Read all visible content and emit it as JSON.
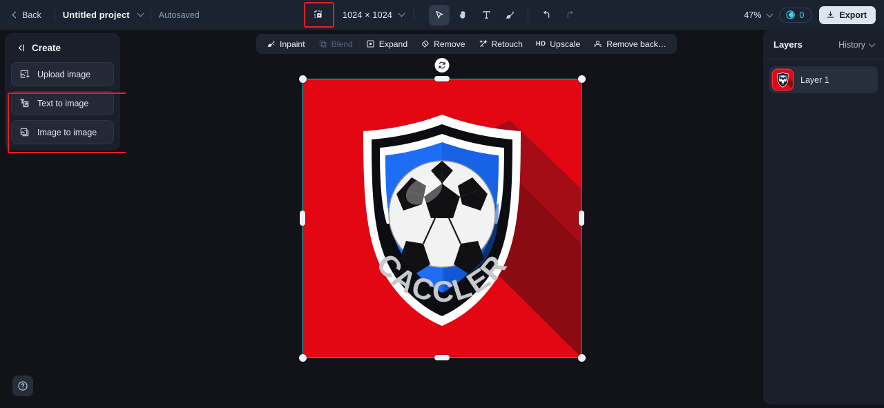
{
  "topbar": {
    "back_label": "Back",
    "project_name": "Untitled project",
    "autosaved_label": "Autosaved",
    "canvas_size": "1024 × 1024",
    "zoom_level": "47%",
    "credits_count": "0",
    "export_label": "Export",
    "icons": {
      "crop": "crop-frame-icon",
      "select": "cursor-select-icon",
      "hand": "hand-pan-icon",
      "text": "text-tool-icon",
      "brush": "brush-tool-icon",
      "undo": "undo-icon",
      "redo": "redo-icon"
    },
    "accent_red": "#ee1c25",
    "accent_cyan": "#3fd2ea"
  },
  "create_panel": {
    "title": "Create",
    "items": [
      {
        "label": "Upload image",
        "icon": "image-upload-icon",
        "highlighted": true
      },
      {
        "label": "Text to image",
        "icon": "text-to-image-icon",
        "highlighted": true
      },
      {
        "label": "Image to image",
        "icon": "image-to-image-icon",
        "highlighted": false
      }
    ]
  },
  "canvas_toolbar": {
    "items": [
      {
        "label": "Inpaint",
        "icon": "inpaint-brush-icon",
        "disabled": false
      },
      {
        "label": "Blend",
        "icon": "blend-icon",
        "disabled": true
      },
      {
        "label": "Expand",
        "icon": "expand-frame-icon",
        "disabled": false
      },
      {
        "label": "Remove",
        "icon": "eraser-icon",
        "disabled": false
      },
      {
        "label": "Retouch",
        "icon": "retouch-sparkle-icon",
        "disabled": false
      },
      {
        "label": "Upscale",
        "icon": "hd-upscale-icon",
        "tag": "HD",
        "disabled": false
      },
      {
        "label": "Remove back…",
        "icon": "remove-background-icon",
        "disabled": false
      }
    ]
  },
  "layers_panel": {
    "title": "Layers",
    "history_label": "History",
    "layers": [
      {
        "name": "Layer 1"
      }
    ]
  },
  "artwork": {
    "brand_text": "CACCLER",
    "background_color": "#e30613",
    "shadow_color": "#8c0a12",
    "shield_blue": "#1d6ef5",
    "shield_black": "#0c0d10",
    "outline_white": "#ffffff"
  },
  "help": {
    "icon": "help-question-icon"
  }
}
